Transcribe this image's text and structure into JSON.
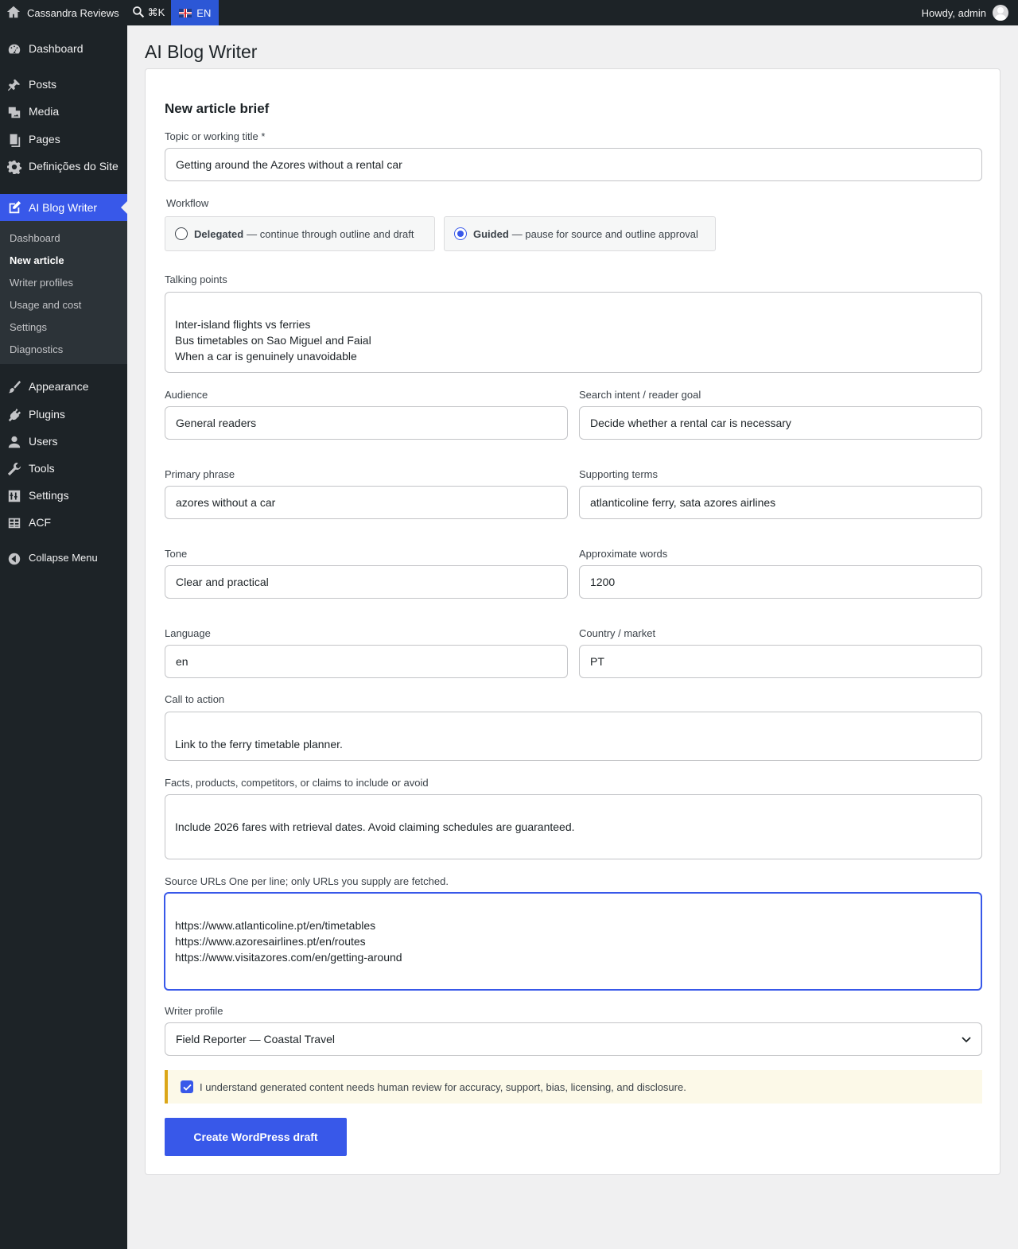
{
  "adminbar": {
    "site_name": "Cassandra Reviews",
    "search_shortcut": "⌘K",
    "language": "EN",
    "greeting": "Howdy, admin"
  },
  "sidebar": {
    "items": [
      {
        "label": "Dashboard",
        "icon": "dashboard-icon"
      },
      {
        "label": "Posts",
        "icon": "pin-icon"
      },
      {
        "label": "Media",
        "icon": "media-icon"
      },
      {
        "label": "Pages",
        "icon": "pages-icon"
      },
      {
        "label": "Definições do Site",
        "icon": "gear-icon"
      },
      {
        "label": "AI Blog Writer",
        "icon": "edit-page-icon"
      },
      {
        "label": "Appearance",
        "icon": "brush-icon"
      },
      {
        "label": "Plugins",
        "icon": "plug-icon"
      },
      {
        "label": "Users",
        "icon": "user-icon"
      },
      {
        "label": "Tools",
        "icon": "wrench-icon"
      },
      {
        "label": "Settings",
        "icon": "sliders-icon"
      },
      {
        "label": "ACF",
        "icon": "table-icon"
      },
      {
        "label": "Collapse Menu",
        "icon": "collapse-icon"
      }
    ],
    "submenu": [
      "Dashboard",
      "New article",
      "Writer profiles",
      "Usage and cost",
      "Settings",
      "Diagnostics"
    ],
    "active_submenu": "New article"
  },
  "page": {
    "title": "AI Blog Writer",
    "section_title": "New article brief"
  },
  "form": {
    "topic": {
      "label": "Topic or working title *",
      "value": "Getting around the Azores without a rental car"
    },
    "workflow": {
      "label": "Workflow",
      "options": [
        {
          "name": "Delegated",
          "desc": "— continue through outline and draft",
          "selected": false
        },
        {
          "name": "Guided",
          "desc": "— pause for source and outline approval",
          "selected": true
        }
      ]
    },
    "talking_points": {
      "label": "Talking points",
      "value": "Inter-island flights vs ferries\nBus timetables on Sao Miguel and Faial\nWhen a car is genuinely unavoidable"
    },
    "audience": {
      "label": "Audience",
      "value": "General readers"
    },
    "search_intent": {
      "label": "Search intent / reader goal",
      "value": "Decide whether a rental car is necessary"
    },
    "primary_phrase": {
      "label": "Primary phrase",
      "value": "azores without a car"
    },
    "supporting_terms": {
      "label": "Supporting terms",
      "value": "atlanticoline ferry, sata azores airlines"
    },
    "tone": {
      "label": "Tone",
      "value": "Clear and practical"
    },
    "approx_words": {
      "label": "Approximate words",
      "value": "1200"
    },
    "language": {
      "label": "Language",
      "value": "en"
    },
    "country": {
      "label": "Country / market",
      "value": "PT"
    },
    "cta": {
      "label": "Call to action",
      "value": "Link to the ferry timetable planner."
    },
    "facts": {
      "label": "Facts, products, competitors, or claims to include or avoid",
      "value": "Include 2026 fares with retrieval dates. Avoid claiming schedules are guaranteed."
    },
    "source_urls": {
      "label": "Source URLs One per line; only URLs you supply are fetched.",
      "value": "https://www.atlanticoline.pt/en/timetables\nhttps://www.azoresairlines.pt/en/routes\nhttps://www.visitazores.com/en/getting-around"
    },
    "writer_profile": {
      "label": "Writer profile",
      "value": "Field Reporter — Coastal Travel"
    },
    "consent": {
      "label": "I understand generated content needs human review for accuracy, support, bias, licensing, and disclosure.",
      "checked": true
    },
    "submit_label": "Create WordPress draft"
  },
  "colors": {
    "accent": "#3858e9",
    "sidebar_bg": "#1d2327",
    "notice_border": "#dba617",
    "notice_bg": "#fcf9e8"
  }
}
